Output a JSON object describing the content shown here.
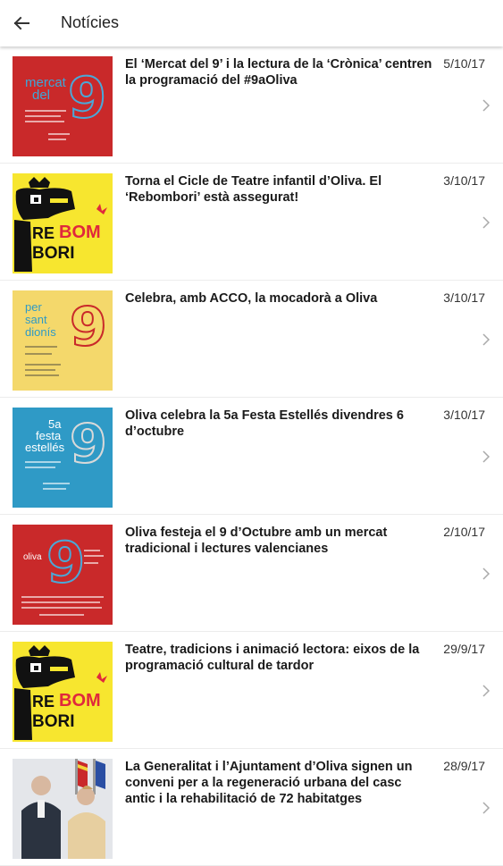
{
  "header": {
    "title": "Notícies",
    "back_icon": "arrow-left-icon"
  },
  "news": [
    {
      "headline": "El ‘Mercat del 9’ i la lectura de la ‘Crònica’ centren la programació del #9aOliva",
      "date": "5/10/17",
      "thumb_text": [
        "mercat",
        "del"
      ]
    },
    {
      "headline": "Torna el Cicle de Teatre infantil d’Oliva. El ‘Rebombori’ està assegurat!",
      "date": "3/10/17",
      "thumb_text": [
        "RE",
        "BOM",
        "BORI"
      ]
    },
    {
      "headline": "Celebra, amb ACCO, la mocadorà a Oliva",
      "date": "3/10/17",
      "thumb_text": [
        "per",
        "sant",
        "dionís"
      ]
    },
    {
      "headline": "Oliva celebra la 5a Festa Estellés divendres 6 d’octubre",
      "date": "3/10/17",
      "thumb_text": [
        "5a",
        "festa",
        "estellés"
      ]
    },
    {
      "headline": "Oliva festeja el 9 d’Octubre amb un mercat tradicional i lectures valencianes",
      "date": "2/10/17",
      "thumb_text": [
        "oliva",
        "9"
      ]
    },
    {
      "headline": "Teatre, tradicions i animació lectora: eixos de la programació cultural de tardor",
      "date": "29/9/17",
      "thumb_text": [
        "RE",
        "BOM",
        "BORI"
      ]
    },
    {
      "headline": "La Generalitat i l’Ajuntament d’Oliva signen un conveni per a la regeneració urbana del casc antic i la rehabilitació de 72 habitatges",
      "date": "28/9/17",
      "thumb_text": []
    }
  ],
  "colors": {
    "red": "#c9292a",
    "yellow": "#f7e62f",
    "cream": "#f4d86b",
    "blue": "#2f9ac6"
  }
}
